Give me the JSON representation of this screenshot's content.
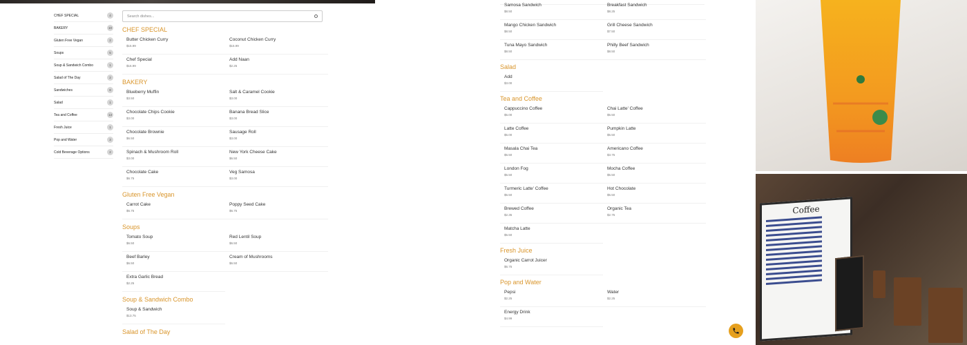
{
  "search": {
    "placeholder": "Search dishes..."
  },
  "sidebar": {
    "items": [
      {
        "label": "CHEF SPECIAL",
        "count": "4"
      },
      {
        "label": "BAKERY",
        "count": "10"
      },
      {
        "label": "Gluten Free Vegan",
        "count": "2"
      },
      {
        "label": "Soups",
        "count": "5"
      },
      {
        "label": "Soup & Sandwich Combo",
        "count": "1"
      },
      {
        "label": "Salad of The Day",
        "count": "2"
      },
      {
        "label": "Sandwiches",
        "count": "8"
      },
      {
        "label": "Salad",
        "count": "1"
      },
      {
        "label": "Tea and Coffee",
        "count": "13"
      },
      {
        "label": "Fresh Juice",
        "count": "1"
      },
      {
        "label": "Pop and Water",
        "count": "3"
      },
      {
        "label": "Cold Beverage Options",
        "count": "2"
      }
    ]
  },
  "left_menu": [
    {
      "title": "CHEF SPECIAL",
      "dishes": [
        {
          "name": "Butter Chicken Curry",
          "price": "$15.99"
        },
        {
          "name": "Coconut Chicken Curry",
          "price": "$15.99"
        },
        {
          "name": "Chef Special",
          "price": "$16.99"
        },
        {
          "name": "Add Naan",
          "price": "$2.25"
        }
      ]
    },
    {
      "title": "BAKERY",
      "dishes": [
        {
          "name": "Blueberry Muffin",
          "price": "$3.50"
        },
        {
          "name": "Salt & Caramel Cookie",
          "price": "$3.00"
        },
        {
          "name": "Chocolate Chips Cookie",
          "price": "$3.00"
        },
        {
          "name": "Banana Bread Slice",
          "price": "$3.00"
        },
        {
          "name": "Chocolate Brownie",
          "price": "$6.50"
        },
        {
          "name": "Sausage Roll",
          "price": "$3.00"
        },
        {
          "name": "Spinach & Mushroom Roll",
          "price": "$3.00"
        },
        {
          "name": "New York Cheese Cake",
          "price": "$6.50"
        },
        {
          "name": "Chocolate Cake",
          "price": "$6.75"
        },
        {
          "name": "Veg Samosa",
          "price": "$3.00"
        }
      ]
    },
    {
      "title": "Gluten Free Vegan",
      "dishes": [
        {
          "name": "Carrot Cake",
          "price": "$6.75"
        },
        {
          "name": "Poppy Seed Cake",
          "price": "$6.75"
        }
      ]
    },
    {
      "title": "Soups",
      "dishes": [
        {
          "name": "Tomato Soup",
          "price": "$6.50"
        },
        {
          "name": "Red Lentil Soup",
          "price": "$6.50"
        },
        {
          "name": "Beef Barley",
          "price": "$6.50"
        },
        {
          "name": "Cream of Mushrooms",
          "price": "$6.50"
        },
        {
          "name": "Extra Garlic Bread",
          "price": "$2.25"
        }
      ]
    },
    {
      "title": "Soup & Sandwich Combo",
      "dishes": [
        {
          "name": "Soup & Sandwich",
          "price": "$13.75"
        }
      ]
    },
    {
      "title": "Salad of The Day",
      "dishes": []
    }
  ],
  "right_menu": [
    {
      "title": "",
      "dishes": [
        {
          "name": "Samosa Sandwich",
          "price": "$8.50"
        },
        {
          "name": "Breakfast Sandwich",
          "price": "$8.25"
        },
        {
          "name": "Mango Chicken Sandwich",
          "price": "$8.50"
        },
        {
          "name": "Grill Cheese Sandwich",
          "price": "$7.50"
        },
        {
          "name": "Tuna Mayo Sandwich",
          "price": "$8.50"
        },
        {
          "name": "Philly Beef Sandwich",
          "price": "$8.50"
        }
      ]
    },
    {
      "title": "Salad",
      "dishes": [
        {
          "name": "Add",
          "price": "$3.00"
        }
      ]
    },
    {
      "title": "Tea and Coffee",
      "dishes": [
        {
          "name": "Cappuccino Coffee",
          "price": "$5.00"
        },
        {
          "name": "Chai Latte' Coffee",
          "price": "$5.50"
        },
        {
          "name": "Latte Coffee",
          "price": "$5.00"
        },
        {
          "name": "Pumpkin Latte",
          "price": "$5.50"
        },
        {
          "name": "Masala Chai Tea",
          "price": "$5.50"
        },
        {
          "name": "Americano Coffee",
          "price": "$3.75"
        },
        {
          "name": "London Fog",
          "price": "$5.50"
        },
        {
          "name": "Mocha Coffee",
          "price": "$5.50"
        },
        {
          "name": "Turmeric Latte' Coffee",
          "price": "$5.50"
        },
        {
          "name": "Hot Chocolate",
          "price": "$5.50"
        },
        {
          "name": "Brewed Coffee",
          "price": "$2.35"
        },
        {
          "name": "Organic Tea",
          "price": "$2.75"
        },
        {
          "name": "Matcha Latte",
          "price": "$5.50"
        }
      ]
    },
    {
      "title": "Fresh Juice",
      "dishes": [
        {
          "name": "Organic Carrot Juicer",
          "price": "$6.75"
        }
      ]
    },
    {
      "title": "Pop and Water",
      "dishes": [
        {
          "name": "Pepsi",
          "price": "$2.25"
        },
        {
          "name": "Water",
          "price": "$2.25"
        },
        {
          "name": "Energy Drink",
          "price": "$4.99"
        }
      ]
    }
  ],
  "photos": {
    "board_title": "Coffee"
  },
  "colors": {
    "accent": "#d9952b",
    "phone_button": "#e6a01e"
  }
}
